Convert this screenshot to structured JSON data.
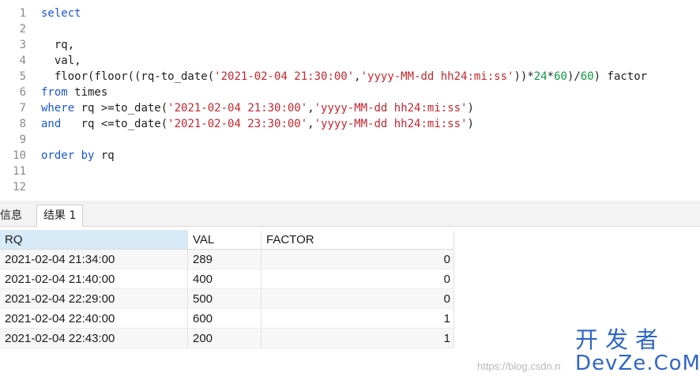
{
  "editor": {
    "line_numbers": [
      "1",
      "2",
      "3",
      "4",
      "5",
      "6",
      "7",
      "8",
      "9",
      "10",
      "11",
      "12"
    ],
    "lines": [
      [
        {
          "t": "select",
          "c": "kw"
        }
      ],
      [],
      [
        {
          "t": "  rq,",
          "c": "plain"
        }
      ],
      [
        {
          "t": "  val,",
          "c": "plain"
        }
      ],
      [
        {
          "t": "  floor(floor((rq-to_date(",
          "c": "plain"
        },
        {
          "t": "'2021-02-04 21:30:00'",
          "c": "str"
        },
        {
          "t": ",",
          "c": "plain"
        },
        {
          "t": "'yyyy-MM-dd hh24:mi:ss'",
          "c": "str"
        },
        {
          "t": "))*",
          "c": "plain"
        },
        {
          "t": "24",
          "c": "num"
        },
        {
          "t": "*",
          "c": "plain"
        },
        {
          "t": "60",
          "c": "num"
        },
        {
          "t": ")/",
          "c": "plain"
        },
        {
          "t": "60",
          "c": "num"
        },
        {
          "t": ") factor",
          "c": "plain"
        }
      ],
      [
        {
          "t": "from",
          "c": "kw"
        },
        {
          "t": " times",
          "c": "plain"
        }
      ],
      [
        {
          "t": "where",
          "c": "kw"
        },
        {
          "t": " rq >=to_date(",
          "c": "plain"
        },
        {
          "t": "'2021-02-04 21:30:00'",
          "c": "str"
        },
        {
          "t": ",",
          "c": "plain"
        },
        {
          "t": "'yyyy-MM-dd hh24:mi:ss'",
          "c": "str"
        },
        {
          "t": ")",
          "c": "plain"
        }
      ],
      [
        {
          "t": "and",
          "c": "kw"
        },
        {
          "t": "   rq <=to_date(",
          "c": "plain"
        },
        {
          "t": "'2021-02-04 23:30:00'",
          "c": "str"
        },
        {
          "t": ",",
          "c": "plain"
        },
        {
          "t": "'yyyy-MM-dd hh24:mi:ss'",
          "c": "str"
        },
        {
          "t": ")",
          "c": "plain"
        }
      ],
      [],
      [
        {
          "t": "order by",
          "c": "kw"
        },
        {
          "t": " rq",
          "c": "plain"
        }
      ],
      [],
      []
    ]
  },
  "tabs": {
    "info_label": "信息",
    "result_label": "结果 1"
  },
  "grid": {
    "columns": [
      "RQ",
      "VAL",
      "FACTOR"
    ],
    "rows": [
      [
        "2021-02-04 21:34:00",
        "289",
        "0"
      ],
      [
        "2021-02-04 21:40:00",
        "400",
        "0"
      ],
      [
        "2021-02-04 22:29:00",
        "500",
        "0"
      ],
      [
        "2021-02-04 22:40:00",
        "600",
        "1"
      ],
      [
        "2021-02-04 22:43:00",
        "200",
        "1"
      ]
    ]
  },
  "watermark": {
    "url": "https://blog.csdn.n",
    "logo_top": "开发者",
    "logo_bottom": "DevZe.CoM"
  }
}
